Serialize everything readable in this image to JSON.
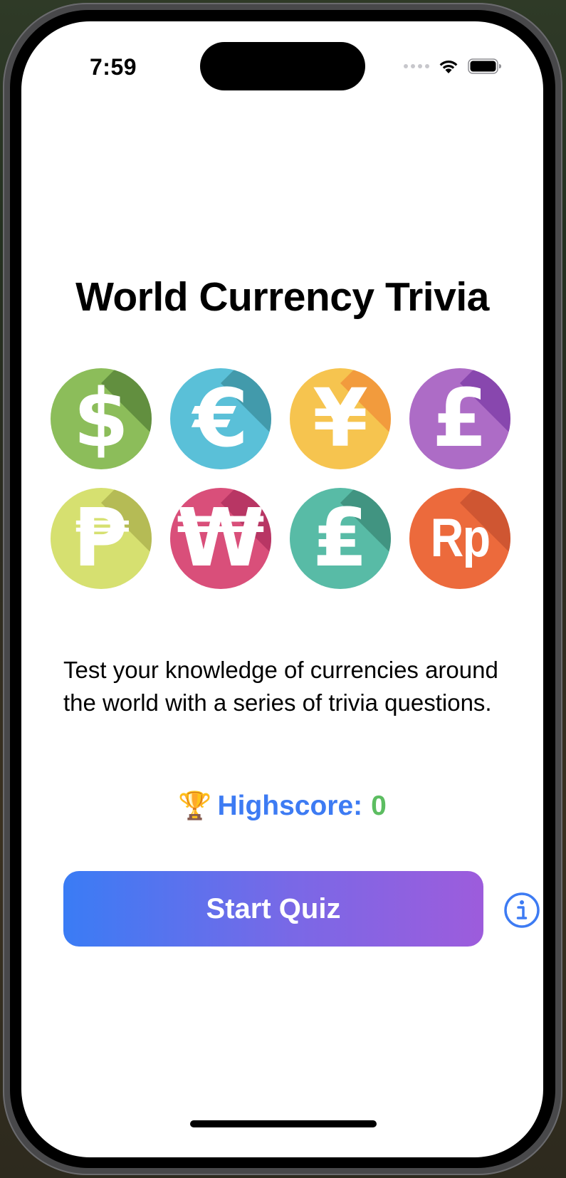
{
  "status_bar": {
    "time": "7:59",
    "icons": [
      "cellular-signal-icon",
      "wifi-icon",
      "battery-icon"
    ]
  },
  "app": {
    "title": "World Currency Trivia",
    "description": "Test your knowledge of currencies around the world with a series of trivia questions.",
    "highscore": {
      "trophy": "🏆",
      "label": "Highscore:",
      "value": "0"
    },
    "start_button_label": "Start Quiz",
    "info_icon": "info-circle-icon"
  },
  "currencies": [
    {
      "name": "dollar",
      "symbol": "$",
      "color": "#8cbd5a",
      "shadow": "#3f6a2a"
    },
    {
      "name": "euro",
      "symbol": "€",
      "color": "#5ac0d8",
      "shadow": "#2f7a87"
    },
    {
      "name": "yen",
      "symbol": "¥",
      "color": "#f6c44f",
      "shadow": "#ef7a30"
    },
    {
      "name": "pound",
      "symbol": "£",
      "color": "#ad6cc6",
      "shadow": "#6a2a9a"
    },
    {
      "name": "peso",
      "symbol": "₱",
      "color": "#d6e070",
      "shadow": "#9a9c40"
    },
    {
      "name": "won",
      "symbol": "₩",
      "color": "#d94f7a",
      "shadow": "#9c2352"
    },
    {
      "name": "lira",
      "symbol": "₤",
      "color": "#58bba6",
      "shadow": "#2f7563"
    },
    {
      "name": "rupiah",
      "symbol": "Rp",
      "color": "#ec6a3c",
      "shadow": "#b8452a"
    }
  ]
}
